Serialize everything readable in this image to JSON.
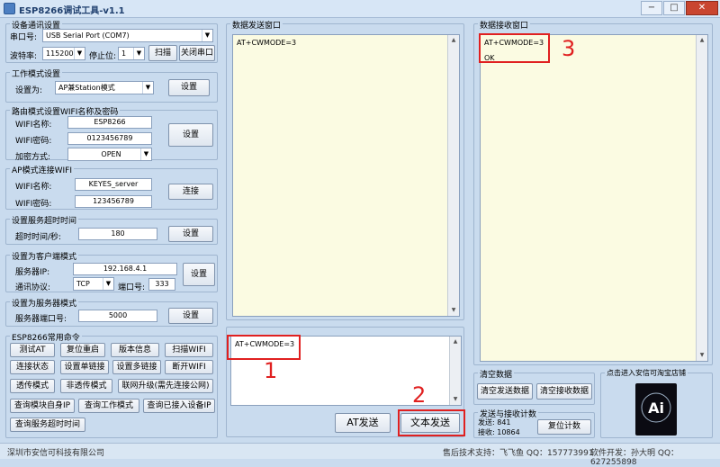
{
  "window": {
    "title": "ESP8266调试工具-v1.1",
    "min": "−",
    "max": "□",
    "close": "✕"
  },
  "serial": {
    "group": "设备通讯设置",
    "port_label": "串口号:",
    "port_value": "USB Serial Port (COM7)",
    "baud_label": "波特率:",
    "baud_value": "115200",
    "stop_label": "停止位:",
    "stop_value": "1",
    "scan": "扫描",
    "close_port": "关闭串口"
  },
  "workmode": {
    "group": "工作模式设置",
    "label": "设置为:",
    "value": "AP兼Station模式",
    "set": "设置"
  },
  "router": {
    "group": "路由模式设置WIFI名称及密码",
    "name_label": "WIFI名称:",
    "name_value": "ESP8266",
    "pwd_label": "WIFI密码:",
    "pwd_value": "0123456789",
    "enc_label": "加密方式:",
    "enc_value": "OPEN",
    "set": "设置"
  },
  "ap": {
    "group": "AP模式连接WIFI",
    "name_label": "WIFI名称:",
    "name_value": "KEYES_server",
    "pwd_label": "WIFI密码:",
    "pwd_value": "123456789",
    "connect": "连接"
  },
  "timeout": {
    "group": "设置服务超时时间",
    "label": "超时时间/秒:",
    "value": "180",
    "set": "设置"
  },
  "client": {
    "group": "设置为客户端模式",
    "ip_label": "服务器IP:",
    "ip_value": "192.168.4.1",
    "proto_label": "通讯协议:",
    "proto_value": "TCP",
    "port_label": "端口号:",
    "port_value": "333",
    "set": "设置"
  },
  "server": {
    "group": "设置为服务器模式",
    "port_label": "服务器端口号:",
    "port_value": "5000",
    "set": "设置"
  },
  "commands": {
    "group": "ESP8266常用命令",
    "buttons": [
      "测试AT",
      "复位重启",
      "版本信息",
      "扫描WIFI",
      "连接状态",
      "设置单链接",
      "设置多链接",
      "断开WIFI",
      "透传模式",
      "非透传模式",
      "联网升级(需先连接公网)",
      "查询模块自身IP",
      "查询工作模式",
      "查询已接入设备IP",
      "查询服务超时时间"
    ]
  },
  "send_window": {
    "title": "数据发送窗口",
    "content": "AT+CWMODE=3"
  },
  "input_box": {
    "content": "AT+CWMODE=3",
    "at_send": "AT发送",
    "text_send": "文本发送"
  },
  "recv_window": {
    "title": "数据接收窗口",
    "line1": "AT+CWMODE=3",
    "line2": "OK"
  },
  "clear": {
    "group": "清空数据",
    "clear_send": "清空发送数据",
    "clear_recv": "清空接收数据"
  },
  "counter": {
    "group": "发送与接收计数",
    "send_label": "发送:",
    "send_value": "841",
    "recv_label": "接收:",
    "recv_value": "10864",
    "reset": "复位计数"
  },
  "shop": {
    "group": "点击进入安信可淘宝店铺",
    "logo": "Ai"
  },
  "annotations": {
    "n1": "1",
    "n2": "2",
    "n3": "3"
  },
  "status": {
    "company": "深圳市安信可科技有限公司",
    "support": "售后技术支持：飞飞鱼 QQ：157773991",
    "dev": "软件开发：孙大明 QQ：627255898"
  },
  "colors": {
    "annotation": "#e02020",
    "textarea": "#fbfbe2",
    "bg": "#c9dbee"
  }
}
